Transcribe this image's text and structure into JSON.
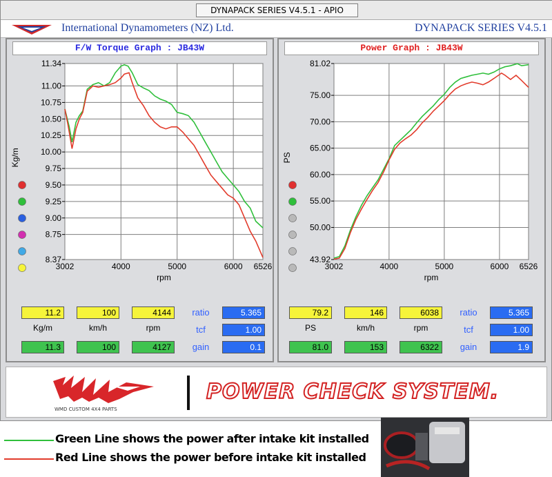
{
  "window": {
    "title": "DYNAPACK SERIES V4.5.1 - APIO"
  },
  "brand": {
    "company": "International Dynamometers (NZ) Ltd.",
    "series": "DYNAPACK SERIES V4.5.1"
  },
  "colors": {
    "after": "#2fbf3b",
    "before": "#e23b2b",
    "green_box": "#3fc34f",
    "yellow_box": "#f6f43a",
    "blue_box": "#2a6cf2",
    "title_blue": "#2a2ae0",
    "title_red": "#e02020"
  },
  "left_panel": {
    "title": "F/W Torque Graph : JB43W",
    "readout": {
      "top": [
        "11.2",
        "100",
        "4144"
      ],
      "units": [
        "Kg/m",
        "km/h",
        "rpm"
      ],
      "bottom": [
        "11.3",
        "100",
        "4127"
      ],
      "ratio_label": "ratio",
      "ratio_value": "5.365",
      "tcf_label": "tcf",
      "tcf_value": "1.00",
      "gain_label": "gain",
      "gain_value": "0.1"
    }
  },
  "right_panel": {
    "title": "Power Graph : JB43W",
    "readout": {
      "top": [
        "79.2",
        "146",
        "6038"
      ],
      "units": [
        "PS",
        "km/h",
        "rpm"
      ],
      "bottom": [
        "81.0",
        "153",
        "6322"
      ],
      "ratio_label": "ratio",
      "ratio_value": "5.365",
      "tcf_label": "tcf",
      "tcf_value": "1.00",
      "gain_label": "gain",
      "gain_value": "1.9"
    }
  },
  "banner": {
    "system_name": "POWER CHECK SYSTEM.",
    "wmd_caption": "WMD CUSTOM 4X4 PARTS"
  },
  "legend": {
    "green_text": "Green Line shows the power after intake kit installed",
    "red_text": "Red Line shows the power before intake kit installed"
  },
  "chart_data": [
    {
      "type": "line",
      "title": "F/W Torque Graph : JB43W",
      "xlabel": "rpm",
      "ylabel": "Kg/m",
      "xlim": [
        3002,
        6526
      ],
      "ylim": [
        8.37,
        11.34
      ],
      "x_ticks": [
        "3002",
        "4000",
        "5000",
        "6000",
        "6526"
      ],
      "y_ticks": [
        "11.34",
        "11.00",
        "10.75",
        "10.50",
        "10.25",
        "10.00",
        "9.75",
        "9.50",
        "9.25",
        "9.00",
        "8.75",
        "8.37"
      ],
      "grid": true,
      "series": [
        {
          "color": "#2fbf3b",
          "x": [
            3002,
            3080,
            3130,
            3200,
            3260,
            3320,
            3400,
            3500,
            3600,
            3700,
            3800,
            3900,
            4000,
            4060,
            4127,
            4200,
            4300,
            4400,
            4500,
            4600,
            4700,
            4800,
            4900,
            5000,
            5100,
            5200,
            5300,
            5400,
            5500,
            5600,
            5700,
            5800,
            5900,
            6000,
            6100,
            6200,
            6300,
            6400,
            6526
          ],
          "y": [
            10.65,
            10.38,
            10.15,
            10.45,
            10.55,
            10.62,
            10.95,
            11.02,
            11.05,
            11.0,
            11.05,
            11.2,
            11.3,
            11.32,
            11.3,
            11.2,
            11.02,
            10.97,
            10.93,
            10.85,
            10.8,
            10.77,
            10.72,
            10.6,
            10.58,
            10.55,
            10.45,
            10.3,
            10.15,
            10.0,
            9.85,
            9.7,
            9.6,
            9.5,
            9.4,
            9.25,
            9.15,
            8.95,
            8.85
          ]
        },
        {
          "color": "#e23b2b",
          "x": [
            3002,
            3060,
            3130,
            3200,
            3260,
            3320,
            3400,
            3500,
            3600,
            3700,
            3800,
            3900,
            4000,
            4060,
            4144,
            4200,
            4300,
            4400,
            4500,
            4600,
            4700,
            4800,
            4900,
            5000,
            5100,
            5200,
            5300,
            5400,
            5500,
            5600,
            5700,
            5800,
            5900,
            6000,
            6100,
            6200,
            6300,
            6400,
            6526
          ],
          "y": [
            10.65,
            10.4,
            10.05,
            10.35,
            10.5,
            10.6,
            10.92,
            11.0,
            10.98,
            11.0,
            11.02,
            11.05,
            11.12,
            11.18,
            11.2,
            11.05,
            10.82,
            10.7,
            10.55,
            10.45,
            10.38,
            10.35,
            10.38,
            10.38,
            10.3,
            10.2,
            10.1,
            9.95,
            9.8,
            9.65,
            9.55,
            9.45,
            9.35,
            9.3,
            9.2,
            9.0,
            8.8,
            8.65,
            8.4
          ]
        }
      ]
    },
    {
      "type": "line",
      "title": "Power Graph : JB43W",
      "xlabel": "rpm",
      "ylabel": "PS",
      "xlim": [
        3002,
        6526
      ],
      "ylim": [
        43.92,
        81.02
      ],
      "x_ticks": [
        "3002",
        "4000",
        "5000",
        "6000",
        "6526"
      ],
      "y_ticks": [
        "81.02",
        "75.00",
        "70.00",
        "65.00",
        "60.00",
        "55.00",
        "50.00",
        "43.92"
      ],
      "grid": true,
      "series": [
        {
          "color": "#2fbf3b",
          "x": [
            3002,
            3100,
            3200,
            3300,
            3400,
            3500,
            3600,
            3700,
            3800,
            3900,
            4000,
            4100,
            4200,
            4300,
            4400,
            4500,
            4600,
            4700,
            4800,
            4900,
            5000,
            5100,
            5200,
            5300,
            5400,
            5500,
            5600,
            5700,
            5800,
            5900,
            6000,
            6100,
            6200,
            6322,
            6400,
            6526
          ],
          "y": [
            44.2,
            44.5,
            46.5,
            49.5,
            52.0,
            54.2,
            56.0,
            57.5,
            59.0,
            61.0,
            63.0,
            65.5,
            66.5,
            67.5,
            68.5,
            69.8,
            71.0,
            72.0,
            73.0,
            74.2,
            75.2,
            76.5,
            77.5,
            78.2,
            78.5,
            78.8,
            79.0,
            79.2,
            79.0,
            79.4,
            80.0,
            80.4,
            80.6,
            81.0,
            80.6,
            80.8
          ]
        },
        {
          "color": "#e23b2b",
          "x": [
            3002,
            3100,
            3200,
            3300,
            3400,
            3500,
            3600,
            3700,
            3800,
            3900,
            4000,
            4100,
            4200,
            4300,
            4400,
            4500,
            4600,
            4700,
            4800,
            4900,
            5000,
            5100,
            5200,
            5300,
            5400,
            5500,
            5600,
            5700,
            5800,
            5900,
            6038,
            6100,
            6200,
            6300,
            6400,
            6526
          ],
          "y": [
            44.0,
            44.2,
            46.0,
            49.0,
            51.5,
            53.5,
            55.3,
            57.0,
            58.5,
            60.5,
            62.8,
            64.8,
            66.0,
            66.8,
            67.5,
            68.5,
            69.8,
            70.8,
            72.0,
            73.0,
            74.0,
            75.2,
            76.2,
            76.8,
            77.2,
            77.5,
            77.3,
            77.0,
            77.5,
            78.2,
            79.2,
            78.8,
            78.0,
            78.8,
            77.8,
            76.5
          ]
        }
      ]
    }
  ]
}
